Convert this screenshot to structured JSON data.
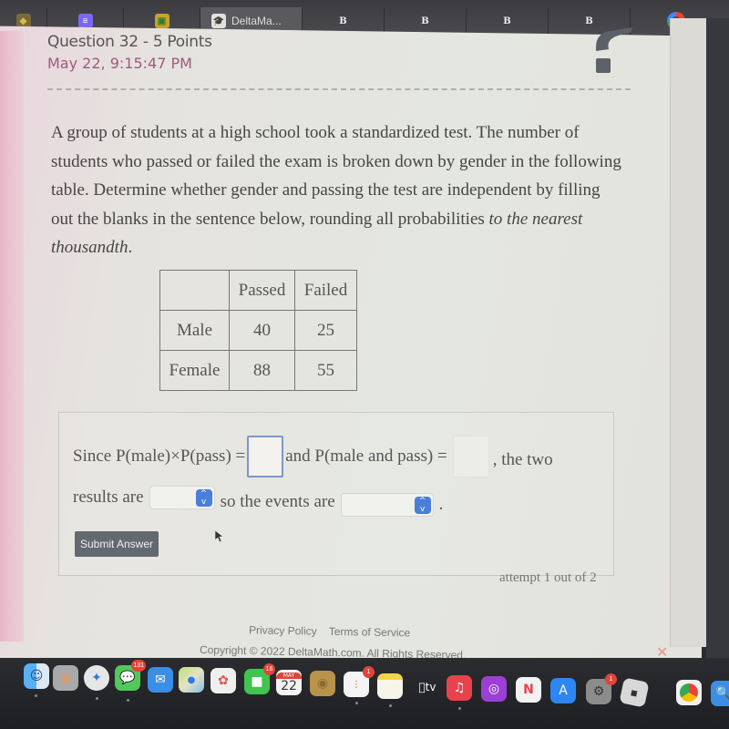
{
  "browser": {
    "tabs": [
      {
        "icon": "shield-icon",
        "label": ""
      },
      {
        "icon": "google-docs-icon",
        "label": ""
      },
      {
        "icon": "google-classroom-icon",
        "label": ""
      },
      {
        "icon": "deltamath-icon",
        "label": "DeltaMa...",
        "active": true
      },
      {
        "icon": "b-icon",
        "label": ""
      },
      {
        "icon": "b-icon",
        "label": ""
      },
      {
        "icon": "b-icon",
        "label": ""
      },
      {
        "icon": "b-icon",
        "label": ""
      },
      {
        "icon": "google-icon",
        "label": ""
      }
    ]
  },
  "question": {
    "title": "Question 32 - 5 Points",
    "date": "May 22, 9:15:47 PM",
    "prompt_plain": "A group of students at a high school took a standardized test. The number of students who passed or failed the exam is broken down by gender in the following table. Determine whether gender and passing the test are independent by filling out the blanks in the sentence below, rounding all probabilities ",
    "prompt_italic": "to the nearest thousandth",
    "prompt_end": "."
  },
  "table": {
    "columns": [
      "",
      "Passed",
      "Failed"
    ],
    "rows": [
      {
        "label": "Male",
        "passed": "40",
        "failed": "25"
      },
      {
        "label": "Female",
        "passed": "88",
        "failed": "55"
      }
    ]
  },
  "answer": {
    "text1": "Since P(male)×P(pass) =",
    "input1_value": "",
    "text2": "and P(male and pass) =",
    "input2_value": "",
    "text3": ", the two",
    "text4": "results are",
    "select1_value": "",
    "text5": "so the events are",
    "select2_value": "",
    "text6": "."
  },
  "submit_label": "Submit Answer",
  "attempt_text": "attempt 1 out of 2",
  "footer": {
    "privacy": "Privacy Policy",
    "terms": "Terms of Service",
    "copyright": "Copyright © 2022 DeltaMath.com. All Rights Reserved."
  },
  "dock": {
    "items": [
      {
        "name": "finder",
        "badge": ""
      },
      {
        "name": "launchpad",
        "badge": ""
      },
      {
        "name": "safari",
        "badge": ""
      },
      {
        "name": "messages",
        "badge": "131"
      },
      {
        "name": "mail",
        "badge": ""
      },
      {
        "name": "maps",
        "badge": ""
      },
      {
        "name": "photos",
        "badge": ""
      },
      {
        "name": "facetime",
        "badge": "16"
      },
      {
        "name": "calendar",
        "badge": "",
        "month": "MAY",
        "day": "22"
      },
      {
        "name": "contacts",
        "badge": ""
      },
      {
        "name": "reminders",
        "badge": "1"
      },
      {
        "name": "notes",
        "badge": ""
      },
      {
        "name": "apple-tv",
        "badge": "",
        "label": "tv"
      },
      {
        "name": "music",
        "badge": ""
      },
      {
        "name": "podcasts",
        "badge": ""
      },
      {
        "name": "news",
        "badge": ""
      },
      {
        "name": "app-store",
        "badge": ""
      },
      {
        "name": "system-preferences",
        "badge": "1"
      },
      {
        "name": "roblox",
        "badge": ""
      },
      {
        "name": "chrome",
        "badge": ""
      },
      {
        "name": "preview",
        "badge": ""
      }
    ]
  },
  "colors": {
    "date_accent": "#a15a7c",
    "input_border": "#7d97c4",
    "select_arrow": "#4a7ed8",
    "submit_bg": "#646870"
  }
}
